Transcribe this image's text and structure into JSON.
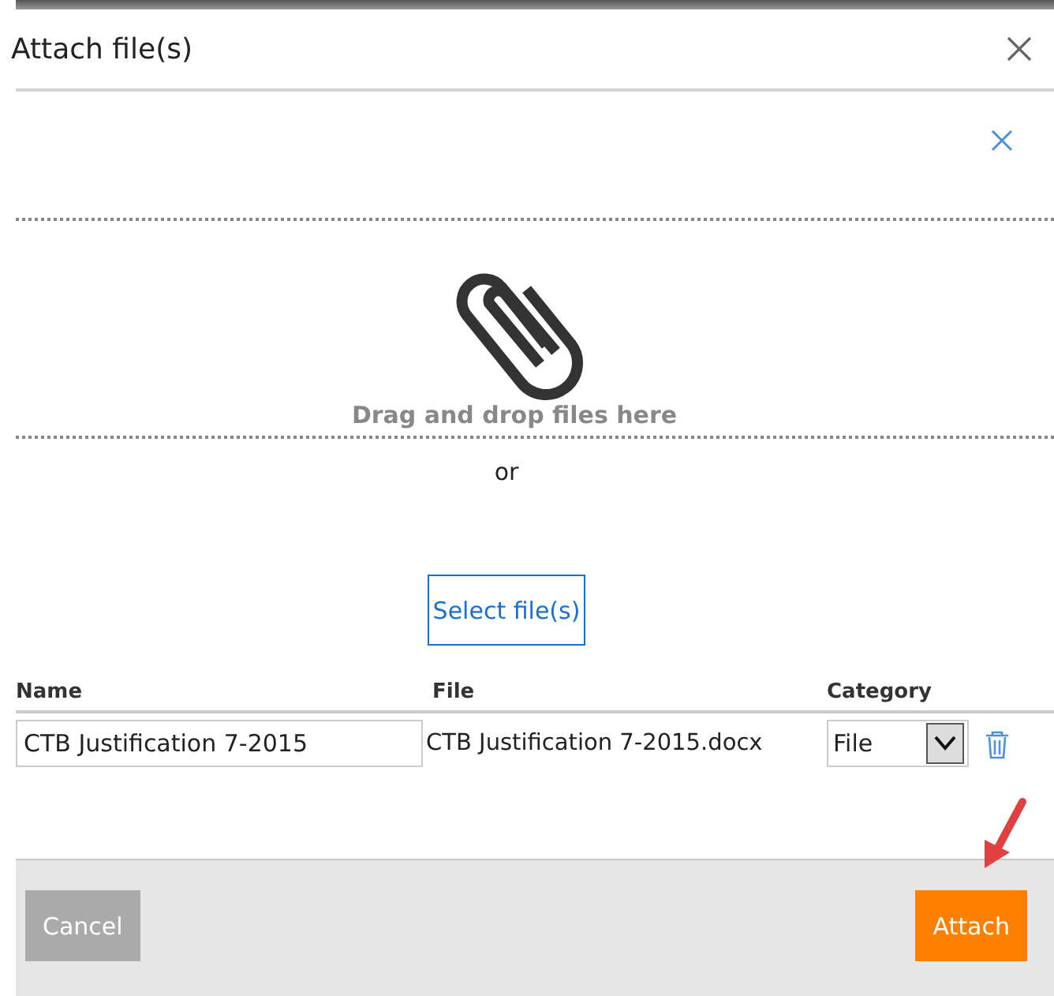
{
  "dialog": {
    "title": "Attach file(s)"
  },
  "dropzone": {
    "text": "Drag and drop files here",
    "separator": "or",
    "select_button": "Select file(s)"
  },
  "table": {
    "columns": [
      "Name",
      "File",
      "Category"
    ],
    "rows": [
      {
        "name": "CTB Justification 7-2015",
        "file": "CTB Justification 7-2015.docx",
        "category": "File"
      }
    ]
  },
  "footer": {
    "buttons": [
      {
        "label": "Cancel",
        "kind": "secondary"
      },
      {
        "label": "Attach",
        "kind": "primary"
      }
    ]
  }
}
